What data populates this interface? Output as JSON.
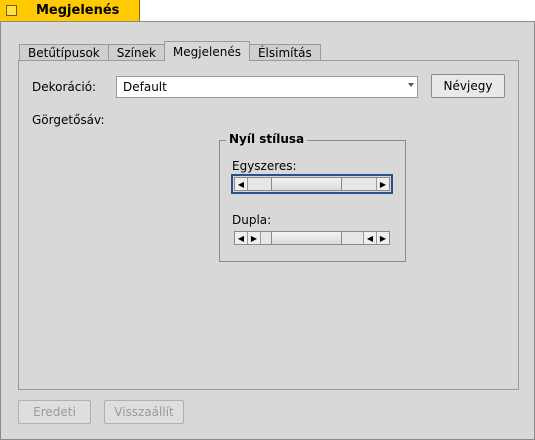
{
  "window": {
    "title": "Megjelenés"
  },
  "tabs": [
    {
      "label": "Betűtípusok"
    },
    {
      "label": "Színek"
    },
    {
      "label": "Megjelenés"
    },
    {
      "label": "Élsimítás"
    }
  ],
  "decoration": {
    "label": "Dekoráció:",
    "value": "Default",
    "about_button": "Névjegy"
  },
  "scrollbar": {
    "label": "Görgetősáv:",
    "arrow_style": {
      "title": "Nyíl stílusa",
      "single_label": "Egyszeres:",
      "double_label": "Dupla:"
    }
  },
  "buttons": {
    "defaults": "Eredeti",
    "revert": "Visszaállít"
  }
}
